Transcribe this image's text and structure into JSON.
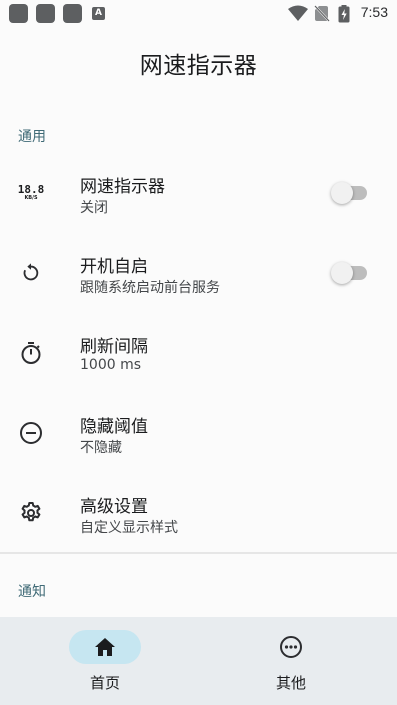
{
  "status_bar": {
    "time": "7:53",
    "notification_icons": [
      "app-icon",
      "app-icon",
      "app-icon",
      "a-icon"
    ],
    "a_badge": "A",
    "system_icons": [
      "wifi-icon",
      "no-sim-icon",
      "battery-charging-icon"
    ]
  },
  "app": {
    "title": "网速指示器"
  },
  "sections": {
    "general": "通用",
    "notification": "通知"
  },
  "preferences": [
    {
      "icon": "speed-readout-icon",
      "icon_value": "18.8",
      "icon_unit": "KB/S",
      "title": "网速指示器",
      "summary": "关闭",
      "switch_on": false
    },
    {
      "icon": "restart-icon",
      "title": "开机自启",
      "summary": "跟随系统启动前台服务",
      "switch_on": false
    },
    {
      "icon": "timer-icon",
      "title": "刷新间隔",
      "summary": "1000 ms"
    },
    {
      "icon": "minus-circle-icon",
      "title": "隐藏阈值",
      "summary": "不隐藏"
    },
    {
      "icon": "gear-icon",
      "title": "高级设置",
      "summary": "自定义显示样式"
    }
  ],
  "bottom_nav": {
    "items": [
      {
        "icon": "home-icon",
        "label": "首页",
        "active": true
      },
      {
        "icon": "more-circle-icon",
        "label": "其他",
        "active": false
      }
    ]
  },
  "colors": {
    "accent": "#3f6a76",
    "active_pill": "#c6e6f1",
    "nav_background": "#e8ecef",
    "switch_track_off": "#bdbdbd"
  }
}
